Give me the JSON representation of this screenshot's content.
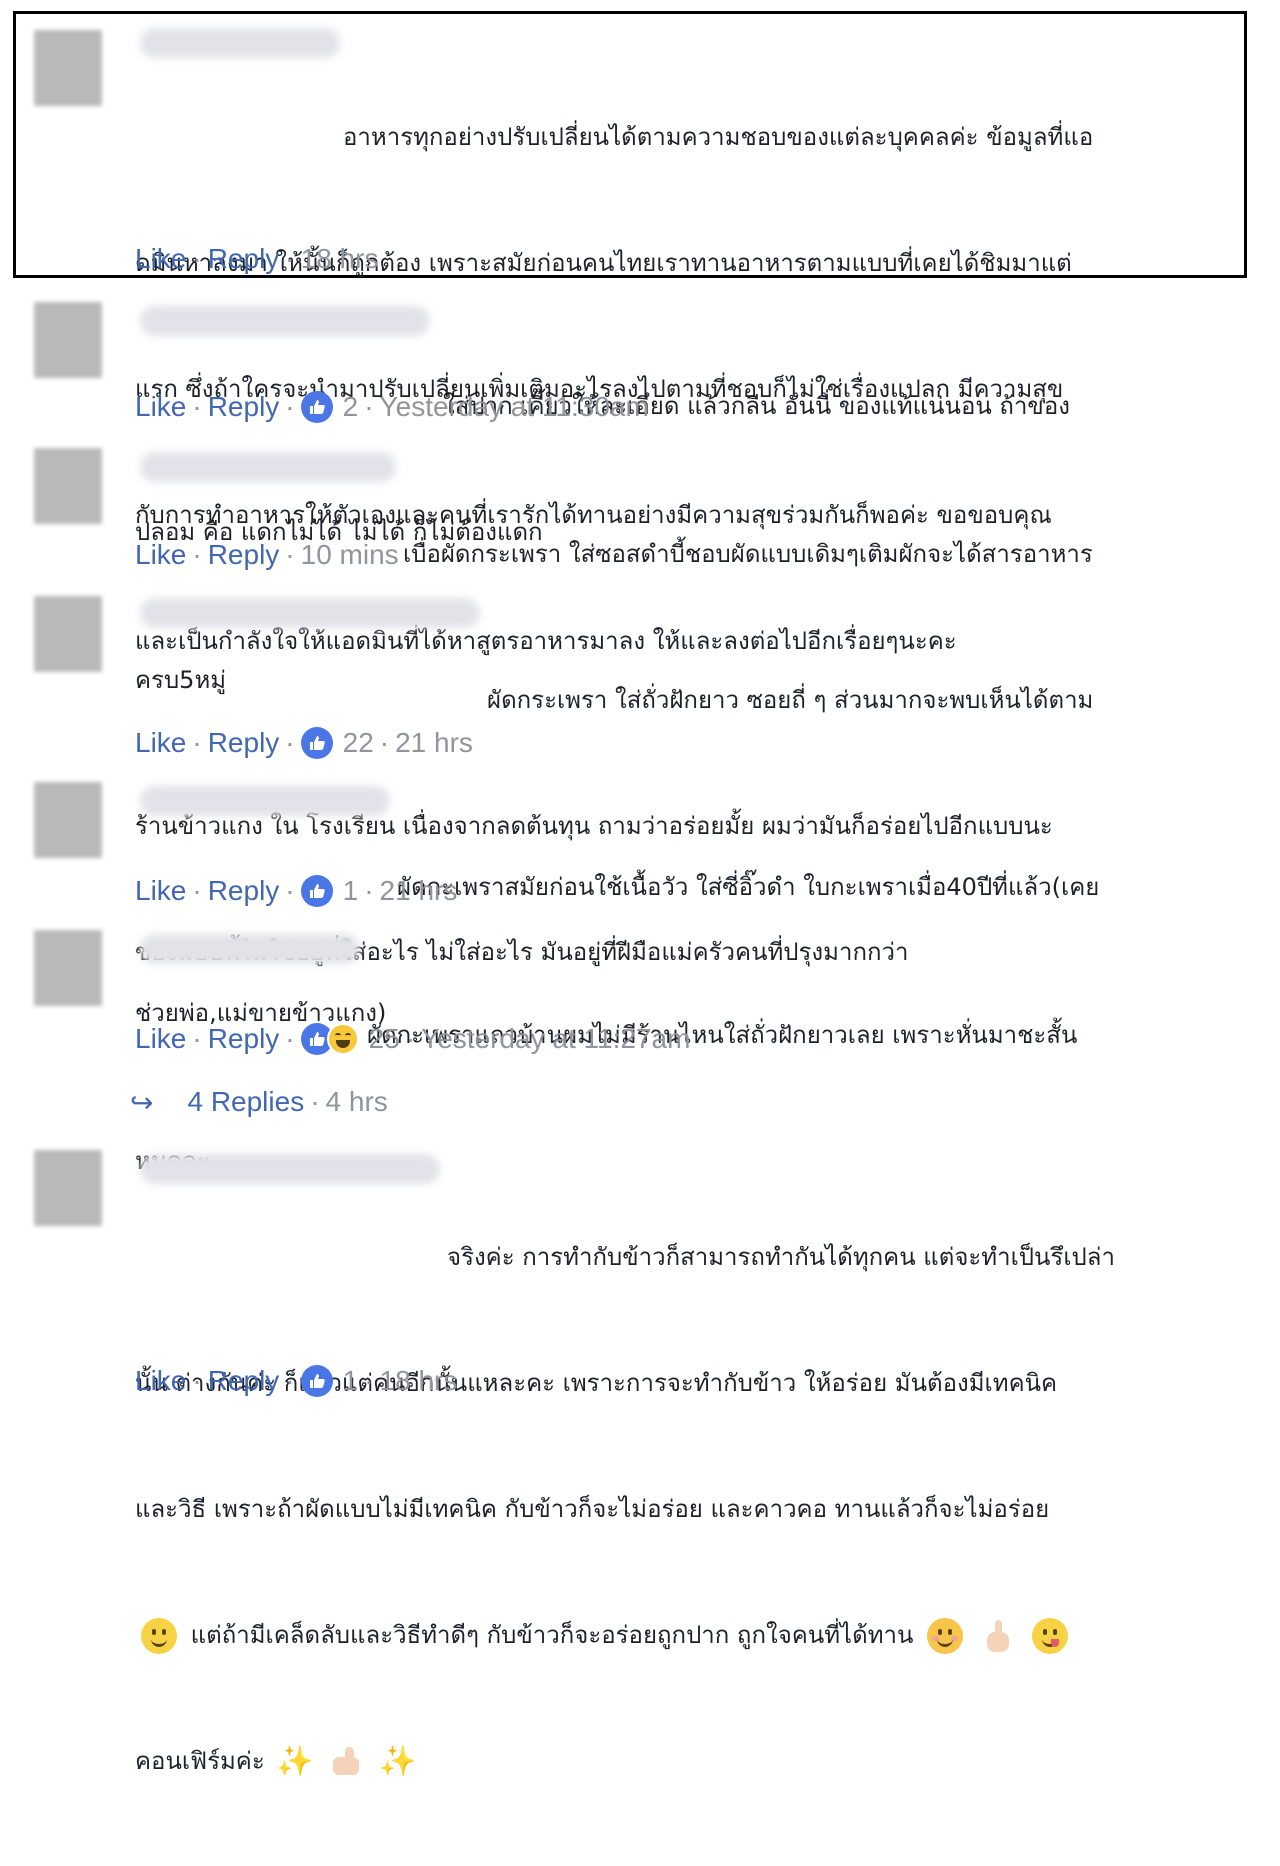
{
  "colors": {
    "link": "#4267b2",
    "meta": "#90949c",
    "text": "#1d2129",
    "like_badge": "#4a77e5"
  },
  "labels": {
    "like": "Like",
    "reply": "Reply",
    "separator": "·"
  },
  "comments": [
    {
      "lines": [
        "อาหารทุกอย่างปรับเปลี่ยนได้ตามความชอบของแต่ละบุคคลค่ะ ข้อมูลที่แอ",
        "ดมินหาลงมา ให้นั้นก็ถูกต้อง เพราะสมัยก่อนคนไทยเราทานอาหารตามแบบที่เคยได้ชิมมาแต่",
        "แรก ซึ่งถ้าใครจะนำมาปรับเปลี่ยนเพิ่มเติมอะไรลงไปตามที่ชอบก็ไม่ใช่เรื่องแปลก มีความสุข",
        "กับการทำอาหารให้ตัวเองและคนที่เรารักได้ทานอย่างมีความสุขร่วมกันก็พอค่ะ ขอขอบคุณ",
        "และเป็นกำลังใจให้แอดมินที่ได้หาสูตรอาหารมาลง ให้และลงต่อไปอีกเรื่อยๆนะคะ"
      ],
      "reactions": "",
      "time": "18 hrs"
    },
    {
      "lines": [
        "ใส่ปาก เคี้ยวให้ละเอียด แล้วกลืน อันนี่ ของแท้แน่นอน ถ้าของ",
        "ปลอม คือ แดกไม่ได้ ไม่ได้ ก็ไม่ต้องแดก"
      ],
      "reactions": "2",
      "time": "Yesterday at 11:30am"
    },
    {
      "lines": [
        "เบื่อผัดกระเพรา ใส่ซอสดำบี้ชอบผัดแบบเดิมๆเติมผักจะได้สารอาหาร",
        "ครบ5หมู่"
      ],
      "reactions": "",
      "time": "10 mins"
    },
    {
      "lines": [
        "ผัดกระเพรา ใส่ถั่วฝักยาว ซอยถี่ ๆ ส่วนมากจะพบเห็นได้ตาม",
        "ร้านข้าวแกง ใน โรงเรียน เนื่องจากลดต้นทุน ถามว่าอร่อยมั้ย ผมว่ามันก็อร่อยไปอีกแบบนะ",
        "ของแบบนี้ไม่ใช่อยู่ที่ใส่อะไร ไม่ใส่อะไร มันอยู่ที่ฝีมือแม่ครัวคนที่ปรุงมากกว่า"
      ],
      "reactions": "22",
      "time": "21 hrs"
    },
    {
      "lines": [
        "ผัดกะเพราสมัยก่อนใช้เนื้อวัว ใส่ซี่อิ๊วดำ ใบกะเพราเมื่อ40ปีที่แล้ว(เคย",
        "ช่วยพ่อ,แม่ขายข้าวแกง)"
      ],
      "reactions": "1",
      "time": "21 hrs"
    },
    {
      "lines": [
        "ผัดกะเพราแถวบ้านผมไม่มีร้านไหนใส่ถั่วฝักยาวเลย เพราะหั่นมาชะสั้น",
        "หมดละ"
      ],
      "reactions": "25",
      "time": "Yesterday at 11:27am"
    },
    {
      "lines": [
        "จริงค่ะ การทำกับข้าวก็สามารถทำกันได้ทุกคน แต่จะทำเป็นรึเปล่า",
        "นั้น ต่างกันค่ะ ก็แล้วแต่คนอีกนั้นแหละคะ เพราะการจะทำกับข้าว ให้อร่อย มันต้องมีเทคนิค",
        "และวิธี เพราะถ้าผัดแบบไม่มีเทคนิค กับข้าวก็จะไม่อร่อย และคาวคอ ทานแล้วก็จะไม่อร่อย",
        "แต่ถ้ามีเคล็ดลับและวิธีทำดีๆ กับข้าวก็จะอร่อยถูกปาก ถูกใจคนที่ได้ทาน",
        "คอนเฟิร์มค่ะ"
      ],
      "reactions": "1",
      "time": "18 hrs"
    }
  ],
  "replies": {
    "count_label": "4 Replies",
    "time": "4 hrs"
  }
}
